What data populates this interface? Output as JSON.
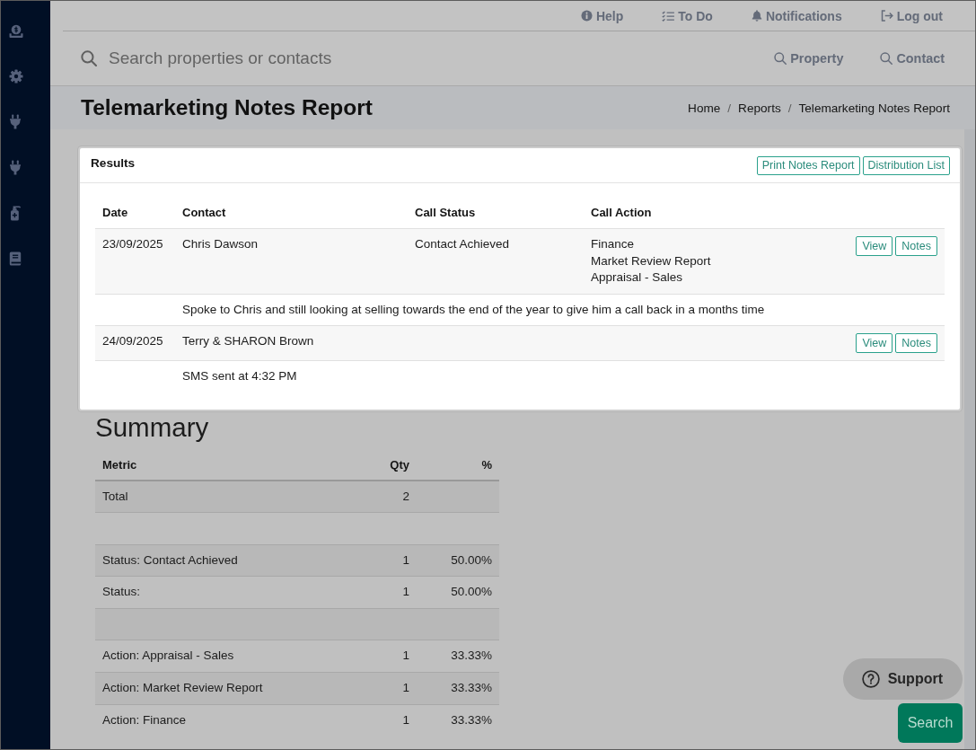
{
  "sidebar": {
    "items": [
      {
        "kind": "coin"
      },
      {
        "kind": "gear"
      },
      {
        "kind": "plug"
      },
      {
        "kind": "plug"
      },
      {
        "kind": "bottle"
      },
      {
        "kind": "book"
      }
    ]
  },
  "top_nav": [
    {
      "kind": "help",
      "label": "Help"
    },
    {
      "kind": "todo",
      "label": "To Do"
    },
    {
      "kind": "bell",
      "label": "Notifications"
    },
    {
      "kind": "logout",
      "label": "Log out"
    }
  ],
  "search": {
    "placeholder": "Search properties or contacts",
    "buttons": [
      {
        "label": "Property"
      },
      {
        "label": "Contact"
      }
    ]
  },
  "page_header": {
    "title": "Telemarketing Notes Report",
    "breadcrumb": [
      {
        "kind": "item",
        "text": "Home"
      },
      {
        "kind": "separator",
        "text": "/"
      },
      {
        "kind": "item",
        "text": "Reports"
      },
      {
        "kind": "separator",
        "text": "/"
      },
      {
        "kind": "item",
        "text": "Telemarketing Notes Report"
      }
    ]
  },
  "results": {
    "title": "Results",
    "buttons": [
      "Print Notes Report",
      "Distribution List"
    ],
    "table": {
      "columns": [
        "Date",
        "Contact",
        "Call Status",
        "Call Action"
      ],
      "rows": [
        {
          "date": "23/09/2025",
          "contact": "Chris Dawson",
          "call_status": "Contact Achieved",
          "call_action": [
            "Finance",
            "Market Review Report",
            "Appraisal - Sales"
          ],
          "buttons": [
            "View",
            "Notes"
          ],
          "note": "Spoke to Chris and still looking at selling towards the end of the year to give him a call back in a months time"
        },
        {
          "date": "24/09/2025",
          "contact": "Terry & SHARON Brown",
          "buttons": [
            "View",
            "Notes"
          ],
          "note": "SMS sent at 4:32 PM"
        }
      ]
    }
  },
  "summary": {
    "title": "Summary",
    "columns": [
      "Metric",
      "Qty",
      "%"
    ],
    "rows": [
      {
        "kind": "data",
        "metric": "Total",
        "qty": "2"
      },
      {
        "kind": "blank"
      },
      {
        "kind": "data",
        "metric": "Status: Contact Achieved",
        "qty": "1",
        "percent": "50.00%"
      },
      {
        "kind": "data",
        "metric": "Status:",
        "qty": "1",
        "percent": "50.00%"
      },
      {
        "kind": "blank"
      },
      {
        "kind": "data",
        "metric": "Action: Appraisal - Sales",
        "qty": "1",
        "percent": "33.33%"
      },
      {
        "kind": "data",
        "metric": "Action: Market Review Report",
        "qty": "1",
        "percent": "33.33%"
      },
      {
        "kind": "data",
        "metric": "Action: Finance",
        "qty": "1",
        "percent": "33.33%"
      }
    ]
  },
  "floating_buttons": [
    {
      "kind": "support",
      "label": "Support"
    },
    {
      "kind": "search",
      "label": "Search"
    }
  ]
}
